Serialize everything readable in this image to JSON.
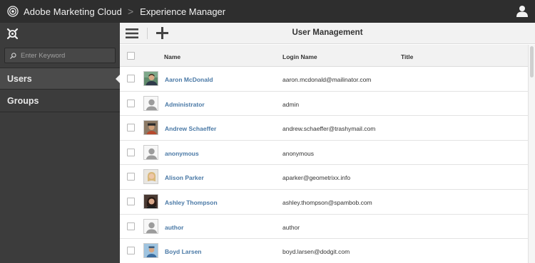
{
  "header": {
    "brand": "Adobe Marketing Cloud",
    "separator": ">",
    "product": "Experience Manager"
  },
  "sidebar": {
    "search_placeholder": "Enter Keyword",
    "items": [
      {
        "label": "Users",
        "active": true
      },
      {
        "label": "Groups",
        "active": false
      }
    ]
  },
  "main": {
    "title": "User Management",
    "columns": {
      "name": "Name",
      "login": "Login Name",
      "title": "Title"
    },
    "rows": [
      {
        "name": "Aaron McDonald",
        "login": "aaron.mcdonald@mailinator.com",
        "avatar": "photo"
      },
      {
        "name": "Administrator",
        "login": "admin",
        "avatar": "default"
      },
      {
        "name": "Andrew Schaeffer",
        "login": "andrew.schaeffer@trashymail.com",
        "avatar": "photo"
      },
      {
        "name": "anonymous",
        "login": "anonymous",
        "avatar": "default"
      },
      {
        "name": "Alison Parker",
        "login": "aparker@geometrixx.info",
        "avatar": "photo"
      },
      {
        "name": "Ashley Thompson",
        "login": "ashley.thompson@spambob.com",
        "avatar": "photo"
      },
      {
        "name": "author",
        "login": "author",
        "avatar": "default"
      },
      {
        "name": "Boyd Larsen",
        "login": "boyd.larsen@dodgit.com",
        "avatar": "photo"
      }
    ]
  },
  "icons": {
    "logo": "adobe-marketing-cloud-logo-icon",
    "user": "user-profile-icon",
    "nav": "navigation-compass-icon",
    "search": "search-icon",
    "menu": "hamburger-menu-icon",
    "add": "plus-icon"
  },
  "colors": {
    "topbar": "#2e2e2e",
    "sidebar": "#3c3c3c",
    "link": "#4a79a6"
  }
}
